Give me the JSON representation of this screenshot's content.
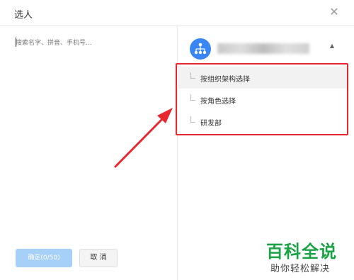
{
  "dialog": {
    "title": "选人",
    "close_icon": "close-icon"
  },
  "search": {
    "placeholder": "搜索名字、拼音、手机号..."
  },
  "buttons": {
    "confirm_label": "确定(0/50)",
    "cancel_label": "取 消"
  },
  "org": {
    "icon": "org-chart-icon",
    "expand_icon": "caret-up-icon"
  },
  "options": [
    {
      "label": "按组织架构选择"
    },
    {
      "label": "按角色选择"
    },
    {
      "label": "研发部"
    }
  ],
  "annotation": {
    "highlight_color": "#e8262d",
    "arrow_color": "#e8262d"
  },
  "watermark": {
    "title": "百科全说",
    "subtitle": "助你轻松解决"
  },
  "colors": {
    "primary_disabled": "#a7d0f8",
    "avatar": "#3b86f5",
    "watermark_green": "#1aa245"
  }
}
